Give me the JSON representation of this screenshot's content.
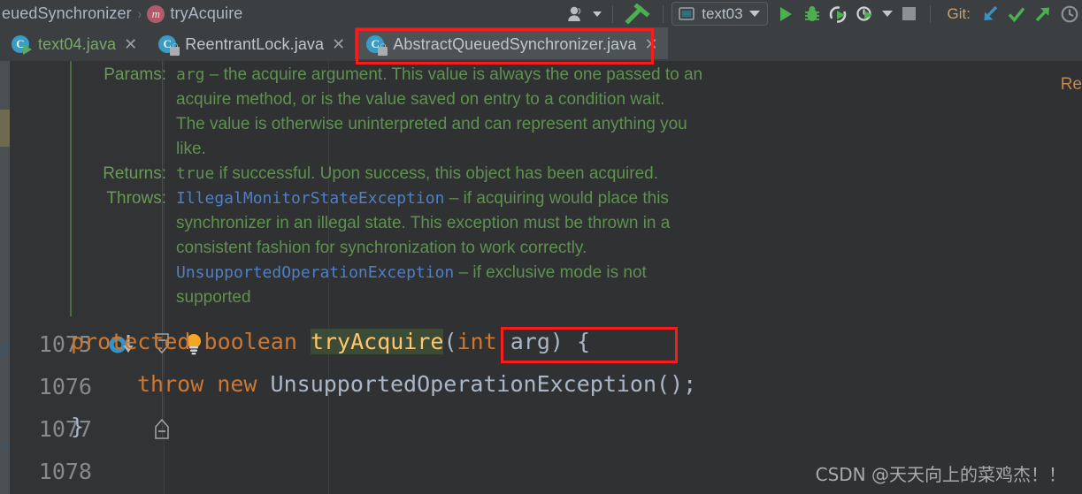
{
  "breadcrumb": {
    "class_name": "euedSynchronizer",
    "separator": "›",
    "method_icon_letter": "m",
    "method_name": "tryAcquire"
  },
  "toolbar": {
    "profile_icon": "user-profile-icon",
    "build_icon": "build-hammer-icon",
    "run_config": {
      "name": "text03",
      "icon": "application-config-icon"
    },
    "run_icon": "run-play-icon",
    "debug_icon": "debug-bug-icon",
    "coverage_icon": "run-with-coverage-icon",
    "profile_icon_run": "run-with-profiler-icon",
    "more_caret": "chevron-down-icon",
    "stop_icon": "stop-square-icon",
    "git_label": "Git:",
    "git_update_icon": "git-update-project-icon",
    "git_commit_icon": "git-commit-check-icon",
    "git_push_icon": "git-push-arrow-icon",
    "git_history_icon": "git-history-clock-icon"
  },
  "tabs": [
    {
      "label": "text04.java",
      "icon": "java-runnable-class-icon",
      "badge": "run",
      "active": false,
      "close": "✕"
    },
    {
      "label": "ReentrantLock.java",
      "icon": "java-library-class-icon",
      "badge": "lock",
      "active": false,
      "close": "✕"
    },
    {
      "label": "AbstractQueuedSynchronizer.java",
      "icon": "java-library-class-icon",
      "badge": "lock",
      "active": true,
      "close": "✕"
    }
  ],
  "javadoc": {
    "params_tag": "Params:",
    "param_name": "arg",
    "param_dash": " – ",
    "param_text_1": "the acquire argument. This value is always the one passed to an",
    "param_text_2": "acquire method, or is the value saved on entry to a condition wait.",
    "param_text_3": "The value is otherwise uninterpreted and can represent anything you",
    "param_text_4": "like.",
    "returns_tag": "Returns:",
    "returns_mono": "true",
    "returns_text": " if successful. Upon success, this object has been acquired.",
    "throws_tag": "Throws:",
    "throws_1_type": "IllegalMonitorStateException",
    "throws_1_dash": " – ",
    "throws_1_text_1": "if acquiring would place this",
    "throws_1_text_2": "synchronizer in an illegal state. This exception must be thrown in a",
    "throws_1_text_3": "consistent fashion for synchronization to work correctly.",
    "throws_2_type": "UnsupportedOperationException",
    "throws_2_dash": " – ",
    "throws_2_text_1": "if exclusive mode is not",
    "throws_2_text_2": "supported"
  },
  "code": {
    "lines": [
      {
        "number": "1075"
      },
      {
        "number": "1076"
      },
      {
        "number": "1077"
      },
      {
        "number": "1078"
      }
    ],
    "line_1075": {
      "kw_protected": "protected",
      "kw_boolean": "boolean",
      "method_name": "tryAcquire",
      "paren_open": "(",
      "kw_int": "int",
      "param": " arg",
      "paren_close": ")",
      "brace": " {"
    },
    "line_1076": {
      "kw_throw": "throw",
      "kw_new": "new",
      "expr": "UnsupportedOperationException();"
    },
    "line_1077": {
      "brace": "}"
    },
    "line_1078": {
      "text": ""
    }
  },
  "gutter_icons": {
    "implements_marker": "implementing-method-icon",
    "fold_collapse": "fold-collapse-icon",
    "intention_bulb": "intention-lightbulb-icon",
    "fold_end": "fold-end-icon"
  },
  "inlay_hint": "Re",
  "watermark": "CSDN @天天向上的菜鸡杰！！",
  "annotations": [
    {
      "name": "active-tab-highlight",
      "color": "#fc1b1b"
    },
    {
      "name": "method-name-highlight",
      "color": "#fc1b1b"
    }
  ],
  "colors": {
    "toolbar_bg": "#3c3f41",
    "editor_bg": "#2f3133",
    "gutter_bg": "#313335",
    "keyword": "#cc7832",
    "method": "#ffc66d",
    "plain": "#a9b7c6",
    "doc_green": "#5f9150",
    "doc_link": "#4f7fc4",
    "annotation_red": "#fc1b1b"
  }
}
